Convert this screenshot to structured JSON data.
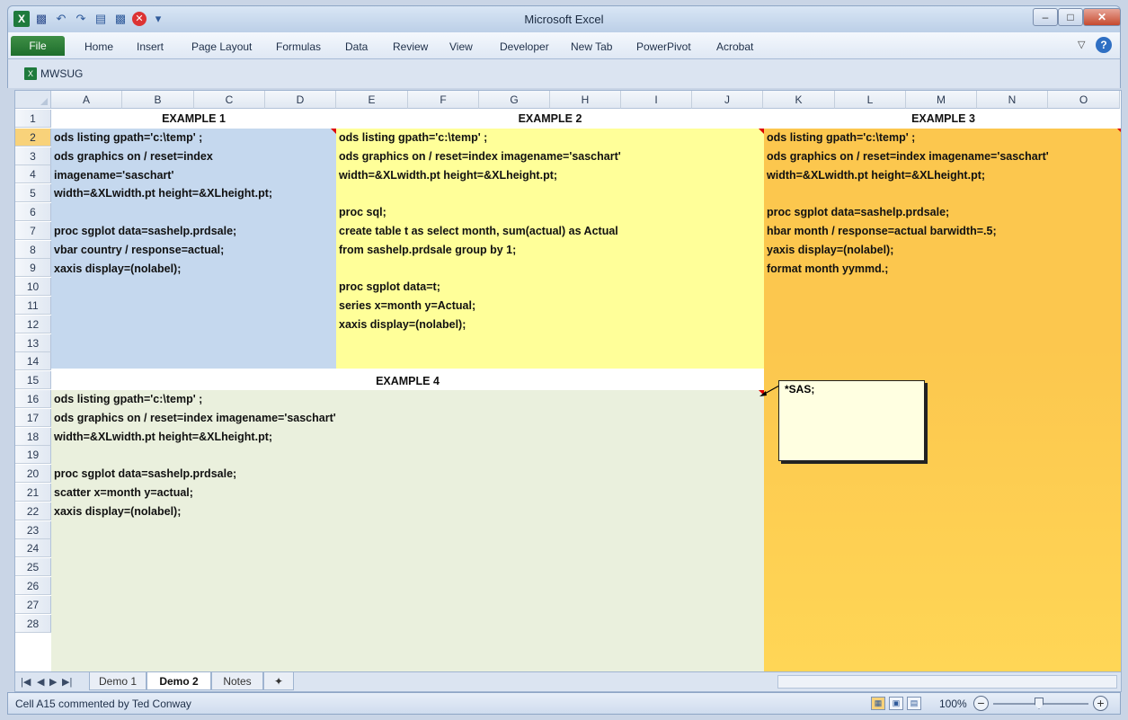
{
  "window": {
    "title": "Microsoft Excel"
  },
  "ribbon": {
    "file_label": "File",
    "tabs": [
      "Home",
      "Insert",
      "Page Layout",
      "Formulas",
      "Data",
      "Review",
      "View",
      "Developer",
      "New Tab",
      "PowerPivot",
      "Acrobat"
    ]
  },
  "workbook": {
    "name": "MWSUG"
  },
  "columns": [
    "A",
    "B",
    "C",
    "D",
    "E",
    "F",
    "G",
    "H",
    "I",
    "J",
    "K",
    "L",
    "M",
    "N",
    "O"
  ],
  "rows": [
    "1",
    "2",
    "3",
    "4",
    "5",
    "6",
    "7",
    "8",
    "9",
    "10",
    "11",
    "12",
    "13",
    "14",
    "15",
    "16",
    "17",
    "18",
    "19",
    "20",
    "21",
    "22",
    "23",
    "24",
    "25",
    "26",
    "27",
    "28"
  ],
  "colors": {
    "example1": "#c5d8ee",
    "example2": "#ffff99",
    "example3": "#fcc74e",
    "example4": "#eaf0dd",
    "selected_row": "#f8d27a"
  },
  "example1": {
    "header": "EXAMPLE 1",
    "lines": [
      "ods listing  gpath='c:\\temp' ;",
      "ods graphics on / reset=index",
      "imagename='saschart'",
      "width=&XLwidth.pt height=&XLheight.pt;",
      "",
      "proc sgplot data=sashelp.prdsale;",
      "vbar country / response=actual;",
      "xaxis display=(nolabel);"
    ]
  },
  "example2": {
    "header": "EXAMPLE 2",
    "lines": [
      "ods listing  gpath='c:\\temp' ;",
      "ods graphics on / reset=index imagename='saschart'",
      "     width=&XLwidth.pt height=&XLheight.pt;",
      "",
      "proc sql;",
      "create table t as select month, sum(actual) as Actual",
      "from sashelp.prdsale group by 1;",
      "",
      "proc sgplot data=t;",
      "series  x=month y=Actual;",
      "xaxis display=(nolabel);"
    ]
  },
  "example3": {
    "header": "EXAMPLE 3",
    "lines": [
      "ods listing  gpath='c:\\temp' ;",
      "ods graphics on / reset=index imagename='saschart'",
      "     width=&XLwidth.pt height=&XLheight.pt;",
      "",
      "proc sgplot data=sashelp.prdsale;",
      "hbar month / response=actual barwidth=.5;",
      "yaxis display=(nolabel);",
      "format month yymmd.;"
    ]
  },
  "example4": {
    "header": "EXAMPLE 4",
    "lines": [
      "ods listing  gpath='c:\\temp' ;",
      "ods graphics on / reset=index imagename='saschart'",
      "     width=&XLwidth.pt height=&XLheight.pt;",
      "",
      "proc sgplot data=sashelp.prdsale;",
      "scatter  x=month y=actual;",
      "xaxis display=(nolabel);"
    ]
  },
  "comment": {
    "text": "*SAS;"
  },
  "sheets": {
    "tabs": [
      "Demo 1",
      "Demo 2",
      "Notes"
    ],
    "active": "Demo 2"
  },
  "status": {
    "text": "Cell A15 commented by Ted Conway",
    "zoom": "100%",
    "zoom_level": 1.0
  }
}
